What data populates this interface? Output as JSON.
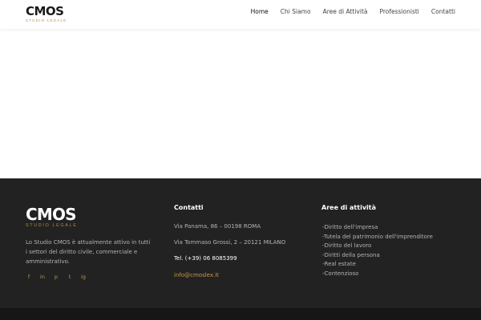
{
  "header": {
    "logo_main": "CMOS",
    "logo_sub": "STUDIO LEGALE",
    "nav": [
      {
        "label": "Home"
      },
      {
        "label": "Chi Siamo"
      },
      {
        "label": "Aree di Attività"
      },
      {
        "label": "Professionisti"
      },
      {
        "label": "Contatti"
      }
    ]
  },
  "footer": {
    "logo_main": "CMOS",
    "logo_sub": "STUDIO LEGALE",
    "about": "Lo Studio CMOS è attualmente attivo in tutti i settori del diritto civile, commerciale e amministrativo.",
    "social": [
      "f",
      "in",
      "p",
      "t",
      "ig"
    ],
    "contacts": {
      "title": "Contatti",
      "address_rome": "Via Panama, 86 – 00198 ROMA",
      "address_milan": "Via Tommaso Grossi, 2 – 20121 MILANO",
      "tel": "Tel. (+39) 06 8085399",
      "email": "info@cmoslex.it"
    },
    "aree": {
      "title": "Aree di attività",
      "items": [
        "-Diritto dell'impresa",
        "-Tutela del patrimonio dell'imprenditore",
        "-Diritto del lavoro",
        "-Diritti della persona",
        "-Real estate",
        "-Contenzioso"
      ]
    }
  },
  "colors": {
    "accent": "#b58a3c",
    "footer_bg": "#222222",
    "bottom_bar": "#161616"
  }
}
